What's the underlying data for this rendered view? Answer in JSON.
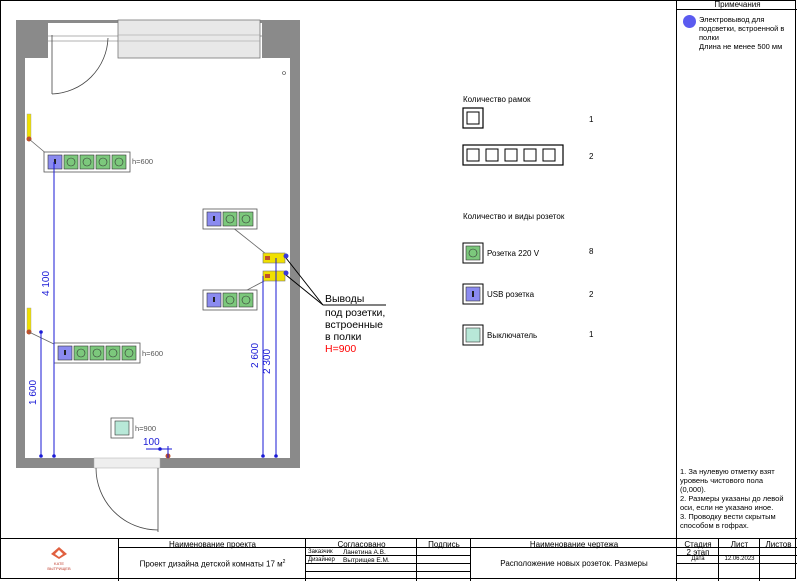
{
  "plan": {
    "sockets_label_1": "h=600",
    "sockets_label_2": "h=600",
    "switch_label": "h=900",
    "callout": {
      "line1": "Выводы",
      "line2": "под розетки,",
      "line3": "встроенные",
      "line4": "в полки",
      "line5": "H=900"
    },
    "dims": {
      "d4100": "4 100",
      "d1600": "1 600",
      "d2600": "2 600",
      "d2300": "2 300",
      "d100": "100"
    },
    "colors": {
      "dimension": "#1a1ad6",
      "socket_fill": "#7cc87c",
      "usb_fill": "#8b8bf0",
      "switch_fill": "#b8e8d8",
      "outlet_yellow": "#f0e000",
      "callout_red": "#ff0000"
    }
  },
  "legend": {
    "frames_title": "Количество рамок",
    "frame1_count": "1",
    "frame5_count": "2",
    "types_title": "Количество и виды розеток",
    "socket_label": "Розетка 220 V",
    "socket_count": "8",
    "usb_label": "USB розетка",
    "usb_count": "2",
    "switch_label": "Выключатель",
    "switch_count": "1"
  },
  "notes": {
    "title": "Примечания",
    "wire_note_1": "Электровывод для",
    "wire_note_2": "подсветки, встроенной в",
    "wire_note_3": "полки",
    "wire_note_4": "Длина не менее 500 мм",
    "general_1": "1. За нулевую отметку взят",
    "general_2": "уровень чистового пола",
    "general_3": "(0,000).",
    "general_4": "2. Размеры указаны до левой",
    "general_5": "оси, если не указано иное.",
    "general_6": "3. Проводку вести скрытым",
    "general_7": "способом в гофрах."
  },
  "title_block": {
    "logo_line1": "KATE",
    "logo_line2": "ВЫТРИЩЕВ",
    "project_head": "Наименование проекта",
    "project_name": "Проект дизайна детской комнаты 17 м",
    "project_sup": "2",
    "agreed_head": "Согласовано",
    "signature_head": "Подпись",
    "client_role": "Заказчик",
    "client_name": "Ланетина А.В.",
    "designer_role": "Дизайнер",
    "designer_name": "Вытрищев Е.М.",
    "drawing_head": "Наименование чертежа",
    "drawing_name": "Расположение новых розеток. Размеры",
    "stage_head": "Стадия",
    "sheet_head": "Лист",
    "sheets_head": "Листов",
    "stage_value": "2 этап",
    "date_head": "Дата",
    "date_value": "12.06.2023"
  }
}
